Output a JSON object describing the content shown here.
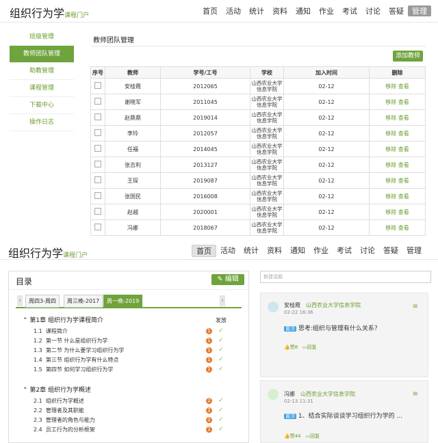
{
  "header": {
    "title": "组织行为学",
    "subtitle": "课程门户",
    "nav": [
      "首页",
      "活动",
      "统计",
      "资料",
      "通知",
      "作业",
      "考试",
      "讨论",
      "答疑",
      "管理"
    ]
  },
  "sidebar": [
    "班级管理",
    "教师团队管理",
    "助教管理",
    "课程管理",
    "下载中心",
    "操作日志"
  ],
  "section_title": "教师团队管理",
  "add_teacher": "添加教师",
  "table": {
    "headers": [
      "序号",
      "教师",
      "学号/工号",
      "学校",
      "加入时间",
      "删除"
    ],
    "rows": [
      {
        "name": "安桂霞",
        "id": "2012065",
        "school": "山西农业大学 信息学院",
        "date": "02-12"
      },
      {
        "name": "谢晓军",
        "id": "2011045",
        "school": "山西农业大学 信息学院",
        "date": "02-12"
      },
      {
        "name": "赵鼎鼎",
        "id": "2019014",
        "school": "山西农业大学 信息学院",
        "date": "02-12"
      },
      {
        "name": "李玲",
        "id": "2012057",
        "school": "山西农业大学 信息学院",
        "date": "02-12"
      },
      {
        "name": "任福",
        "id": "2014045",
        "school": "山西农业大学 信息学院",
        "date": "02-12"
      },
      {
        "name": "张吉利",
        "id": "2013127",
        "school": "山西农业大学 信息学院",
        "date": "02-12"
      },
      {
        "name": "王琛",
        "id": "2019087",
        "school": "山西农业大学 信息学院",
        "date": "02-12"
      },
      {
        "name": "张国民",
        "id": "2016008",
        "school": "山西农业大学 信息学院",
        "date": "02-12"
      },
      {
        "name": "赵越",
        "id": "2020001",
        "school": "山西农业大学 信息学院",
        "date": "02-12"
      },
      {
        "name": "冯娜",
        "id": "2018067",
        "school": "山西农业大学 信息学院",
        "date": "02-12"
      }
    ],
    "remove": "移除",
    "view": "查看"
  },
  "lower": {
    "toc_title": "目录",
    "edit": "编辑",
    "tabs": [
      "周四3-周四",
      "周三晚-2017",
      "周一晚-2019"
    ],
    "publish": "发放",
    "chapters": [
      {
        "title": "第1章 组织行为学课程简介",
        "lessons": [
          {
            "num": "1.1",
            "t": "课程简介",
            "b": "1"
          },
          {
            "num": "1.2",
            "t": "第一节 什么是组织行为学",
            "b": "1"
          },
          {
            "num": "1.3",
            "t": "第二节 为什么要学习组织行为学",
            "b": "1"
          },
          {
            "num": "1.4",
            "t": "第三节 组织行为学有什么特点",
            "b": "1"
          },
          {
            "num": "1.5",
            "t": "第四节 如何学习组织行为学",
            "b": "1"
          }
        ]
      },
      {
        "title": "第2章 组织行为学概述",
        "lessons": [
          {
            "num": "2.1",
            "t": "组织行为学概述",
            "b": "2"
          },
          {
            "num": "2.2",
            "t": "管理者及其职能",
            "b": "2"
          },
          {
            "num": "2.3",
            "t": "管理者的角色与能力",
            "b": "2"
          },
          {
            "num": "2.4",
            "t": "员工行为的分析框架",
            "b": "2"
          }
        ]
      }
    ],
    "new_topic": "新建话题",
    "posts": [
      {
        "user": "安桂霞",
        "org": "山西农业大学信息学院",
        "time": "02-22 16:36",
        "tag": "置顶",
        "text": "思考:组织与管理有什么关系？",
        "likes": "赞8",
        "reply": "回复"
      },
      {
        "user": "冯娜",
        "org": "山西农业大学信息学院",
        "time": "02-13 11:31",
        "tag": "置顶",
        "text": "1、结合实际谈谈学习组织行为学的 ...",
        "likes": "赞44",
        "reply": "回复"
      }
    ]
  },
  "colors": {
    "accent": "#6fa33b",
    "badge": "#e87a2c",
    "tag": "#3aa0e0"
  }
}
